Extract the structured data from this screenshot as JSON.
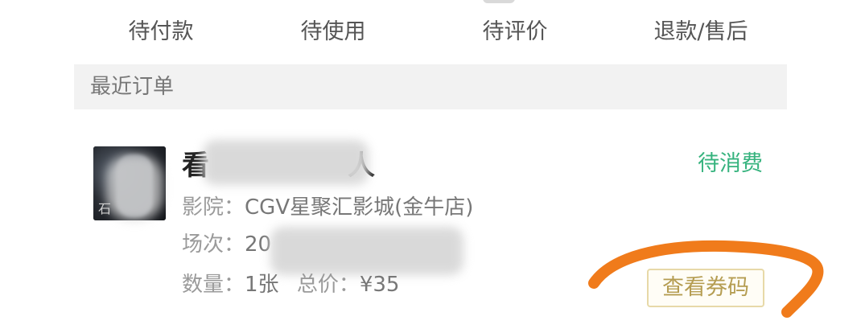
{
  "tabs": [
    {
      "label": "待付款"
    },
    {
      "label": "待使用"
    },
    {
      "label": "待评价"
    },
    {
      "label": "退款/售后"
    }
  ],
  "section": {
    "title": "最近订单"
  },
  "order": {
    "title_prefix": "看",
    "title_suffix": "人",
    "status": "待消费",
    "cinema_label": "影院：",
    "cinema": "CGV星聚汇影城(金牛店)",
    "session_label": "场次：",
    "session_value": "20",
    "quantity_label": "数量：",
    "quantity_value": "1张",
    "total_label": "总价：",
    "total_value": "¥35",
    "ticket_button": "查看券码",
    "poster_glyph": "石"
  },
  "colors": {
    "status_green": "#36b37e",
    "button_gold": "#b59d52",
    "annotation_orange": "#f07b1b"
  }
}
